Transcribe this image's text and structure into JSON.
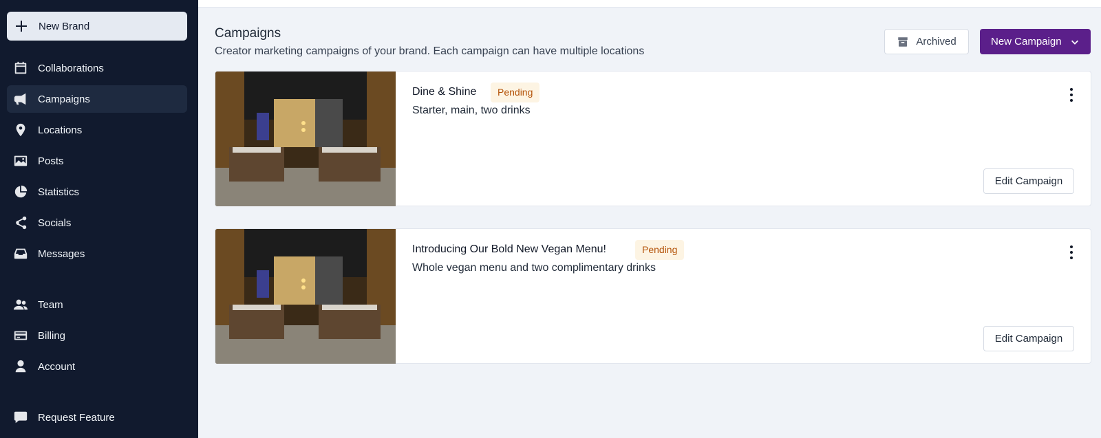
{
  "sidebar": {
    "new_brand_label": "New Brand",
    "items": [
      {
        "label": "Collaborations",
        "icon": "calendar-icon"
      },
      {
        "label": "Campaigns",
        "icon": "megaphone-icon",
        "active": true
      },
      {
        "label": "Locations",
        "icon": "map-pin-icon"
      },
      {
        "label": "Posts",
        "icon": "image-icon"
      },
      {
        "label": "Statistics",
        "icon": "pie-chart-icon"
      },
      {
        "label": "Socials",
        "icon": "share-icon"
      },
      {
        "label": "Messages",
        "icon": "inbox-icon"
      },
      {
        "label": "Team",
        "icon": "users-icon"
      },
      {
        "label": "Billing",
        "icon": "credit-card-icon"
      },
      {
        "label": "Account",
        "icon": "user-icon"
      },
      {
        "label": "Request Feature",
        "icon": "chat-bubble-icon"
      }
    ]
  },
  "header": {
    "title": "Campaigns",
    "subtitle": "Creator marketing campaigns of your brand. Each campaign can have multiple locations",
    "archived_label": "Archived",
    "new_campaign_label": "New Campaign"
  },
  "campaigns": [
    {
      "title": "Dine & Shine",
      "status": "Pending",
      "description": "Starter, main, two drinks",
      "edit_label": "Edit Campaign"
    },
    {
      "title": "Introducing Our Bold New Vegan Menu!",
      "status": "Pending",
      "description": "Whole vegan menu and two complimentary drinks",
      "edit_label": "Edit Campaign"
    }
  ],
  "colors": {
    "sidebar_bg": "#111a2e",
    "accent": "#5b1f8a",
    "pending_bg": "#fdf4e3",
    "pending_text": "#b45309"
  }
}
